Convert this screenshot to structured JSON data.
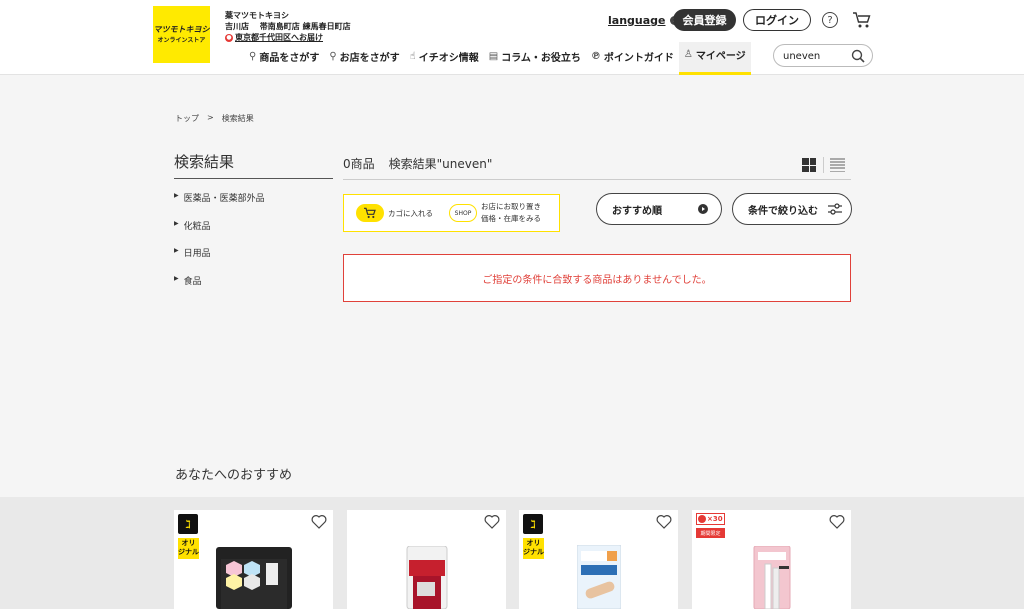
{
  "header": {
    "logo_line1": "マツモトキヨシ",
    "logo_line2": "オンラインストア",
    "store_brand": "薬マツモトキヨシ",
    "store_name": "吉川店 　帯南島町店 練馬春日町店",
    "delivery_text": "東京都千代田区へお届け",
    "language_label": "language",
    "register_label": "会員登録",
    "login_label": "ログイン",
    "help_label": "?"
  },
  "nav": {
    "items": [
      {
        "label": "商品をさがす",
        "icon": "search-icon"
      },
      {
        "label": "お店をさがす",
        "icon": "location-pin-icon"
      },
      {
        "label": "イチオシ情報",
        "icon": "thumbs-up-icon"
      },
      {
        "label": "コラム・お役立ち",
        "icon": "document-icon"
      },
      {
        "label": "ポイントガイド",
        "icon": "point-icon"
      },
      {
        "label": "マイページ",
        "icon": "user-icon"
      }
    ],
    "active_index": 5
  },
  "search": {
    "value": "uneven"
  },
  "breadcrumb": {
    "home": "トップ",
    "separator": ">",
    "current": "検索結果"
  },
  "sidebar": {
    "title": "検索結果",
    "categories": [
      {
        "label": "医薬品・医薬部外品"
      },
      {
        "label": "化粧品"
      },
      {
        "label": "日用品"
      },
      {
        "label": "食品"
      }
    ]
  },
  "results": {
    "count": "0商品",
    "query_label": "検索結果\"uneven\"",
    "empty_message": "ご指定の条件に合致する商品はありませんでした。"
  },
  "legend": {
    "cart_label": "カゴに入れる",
    "pickup_line1": "お店にお取り置き",
    "pickup_line2": "価格・在庫をみる",
    "shop_badge": "SHOP"
  },
  "controls": {
    "sort_label": "おすすめ順",
    "filter_label": "条件で絞り込む"
  },
  "recommend": {
    "title": "あなたへのおすすめ",
    "original_tag": "オリ ジナル",
    "points_label": "×30",
    "limited_label": "期間限定"
  },
  "colors": {
    "brand_yellow": "#ffe100",
    "error_red": "#e0413a",
    "dark": "#333333"
  }
}
